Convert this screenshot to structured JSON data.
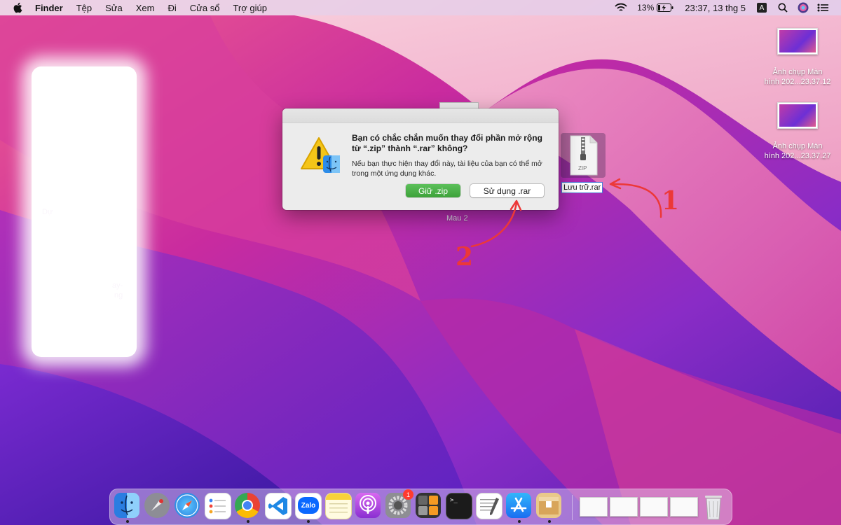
{
  "menubar": {
    "app_name": "Finder",
    "menus": [
      "Tệp",
      "Sửa",
      "Xem",
      "Đi",
      "Cửa sổ",
      "Trợ giúp"
    ],
    "battery_percent": "13%",
    "clock": "23:37, 13 thg 5",
    "input_source": "A",
    "icons": [
      "apple-icon",
      "wifi-icon",
      "battery-icon",
      "input-source-icon",
      "search-icon",
      "siri-icon",
      "control-center-icon"
    ]
  },
  "desktop": {
    "icons": [
      {
        "label_line1": "Ảnh chụp Màn",
        "label_line2": "hình 202...23.37.12"
      },
      {
        "label_line1": "Ảnh chụp Màn",
        "label_line2": "hình 202...23.37.27"
      }
    ],
    "rar_file": {
      "label": "Lưu trữ.rar",
      "badge": "ZIP"
    },
    "mau_label": "Mau 2",
    "blurred_fragments": [
      "Dự",
      "ay-",
      "ng"
    ]
  },
  "dialog": {
    "title": "Bạn có chắc chắn muốn thay đổi phần mở rộng từ “.zip” thành “.rar” không?",
    "message": "Nếu bạn thực hiện thay đổi này, tài liệu của bạn có thể mở trong một ứng dụng khác.",
    "keep_button": "Giữ .zip",
    "use_button": "Sử dụng .rar"
  },
  "annotations": {
    "step1": "1",
    "step2": "2",
    "color": "#ec3838"
  },
  "dock": {
    "apps": [
      {
        "name": "finder-icon",
        "running": true
      },
      {
        "name": "launchpad-icon",
        "running": false
      },
      {
        "name": "safari-icon",
        "running": false
      },
      {
        "name": "reminders-icon",
        "running": false
      },
      {
        "name": "chrome-icon",
        "running": true
      },
      {
        "name": "vscode-icon",
        "running": false
      },
      {
        "name": "zalo-icon",
        "running": true
      },
      {
        "name": "notes-icon",
        "running": false
      },
      {
        "name": "podcasts-icon",
        "running": false
      },
      {
        "name": "system-preferences-icon",
        "running": false,
        "badge": "1"
      },
      {
        "name": "calculator-icon",
        "running": false
      },
      {
        "name": "terminal-icon",
        "running": false
      },
      {
        "name": "textedit-icon",
        "running": false
      },
      {
        "name": "app-store-icon",
        "running": true
      },
      {
        "name": "archive-utility-icon",
        "running": true
      }
    ],
    "zalo_label": "Zalo",
    "terminal_prompt": ">_",
    "recent_windows": 4
  }
}
